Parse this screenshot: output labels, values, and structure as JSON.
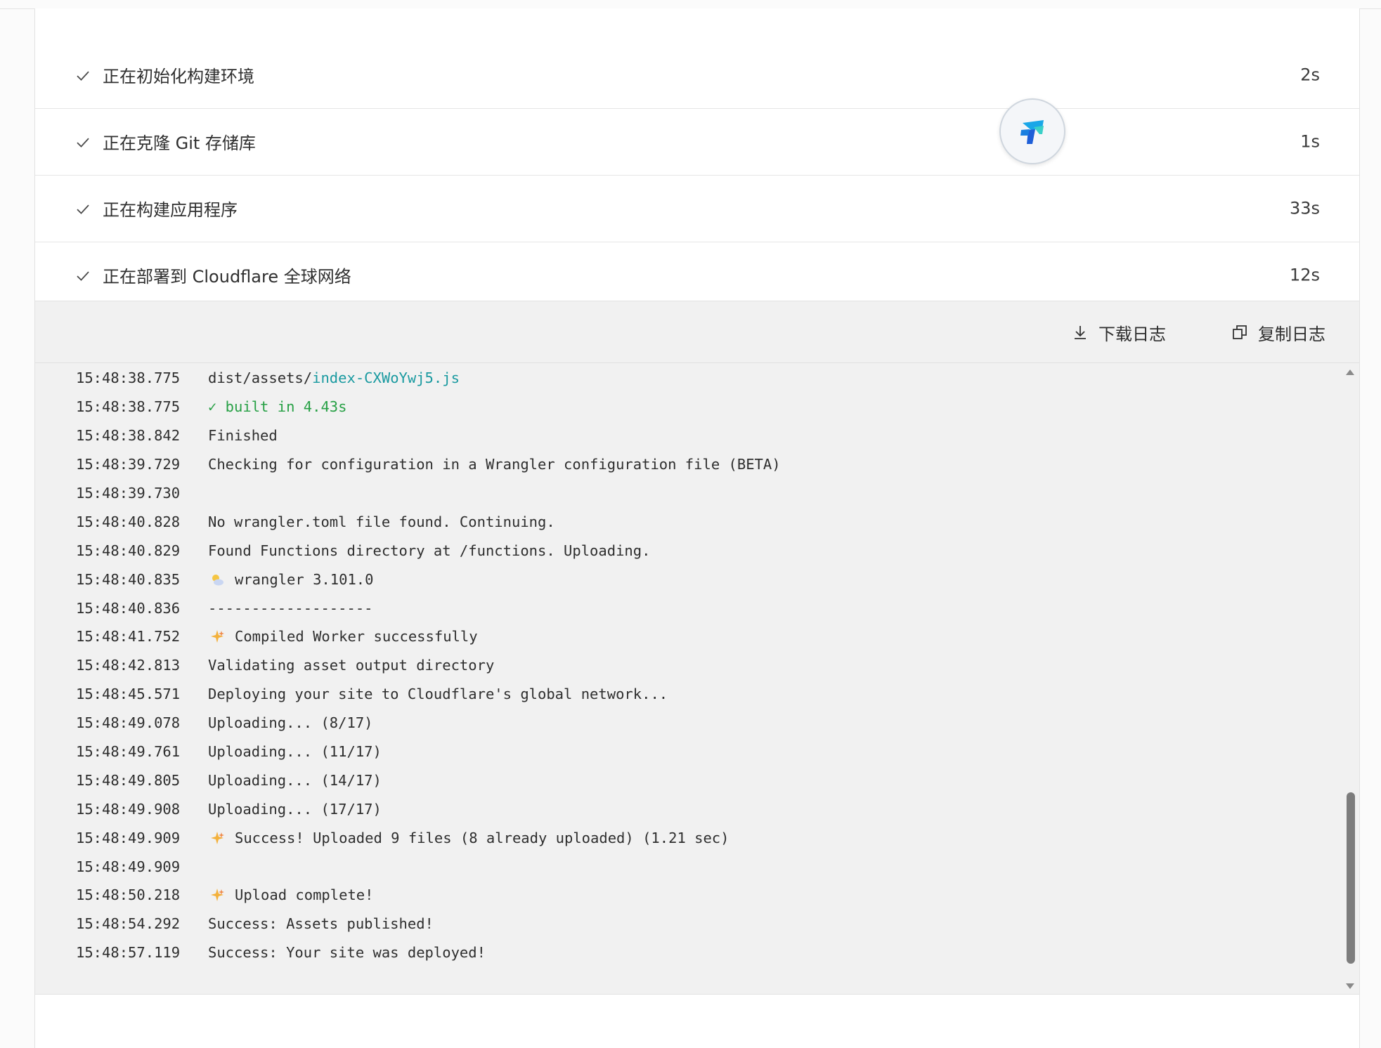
{
  "steps": [
    {
      "label": "正在初始化构建环境",
      "duration": "2s",
      "status_icon": "check-icon"
    },
    {
      "label": "正在克隆 Git 存储库",
      "duration": "1s",
      "status_icon": "check-icon"
    },
    {
      "label": "正在构建应用程序",
      "duration": "33s",
      "status_icon": "check-icon"
    },
    {
      "label": "正在部署到 Cloudflare 全球网络",
      "duration": "12s",
      "status_icon": "check-icon"
    }
  ],
  "toolbar": {
    "download_label": "下载日志",
    "download_icon": "download-icon",
    "copy_label": "复制日志",
    "copy_icon": "copy-icon"
  },
  "floating_badge": {
    "icon": "app-logo-icon",
    "colors": [
      "#1aa7e8",
      "#1e5fd8",
      "#3ad0c8"
    ]
  },
  "colors": {
    "success_green": "#27a045",
    "link_teal": "#1a9aa0",
    "log_background": "#f1f1f1",
    "check_color": "#4a4a4a"
  },
  "log": {
    "lines": [
      {
        "time": "15:48:38.775",
        "prefix": "dist/assets/",
        "text": "",
        "highlight": "index-CXWoYwj5.js",
        "highlight_color": "teal"
      },
      {
        "time": "15:48:38.775",
        "prefix": "",
        "text": "",
        "highlight": "✓ built in 4.43s",
        "highlight_color": "green"
      },
      {
        "time": "15:48:38.842",
        "prefix": "",
        "text": "Finished"
      },
      {
        "time": "15:48:39.729",
        "prefix": "",
        "text": "Checking for configuration in a Wrangler configuration file (BETA)"
      },
      {
        "time": "15:48:39.730",
        "prefix": "",
        "text": ""
      },
      {
        "time": "15:48:40.828",
        "prefix": "",
        "text": "No wrangler.toml file found. Continuing."
      },
      {
        "time": "15:48:40.829",
        "prefix": "",
        "text": "Found Functions directory at /functions. Uploading."
      },
      {
        "time": "15:48:40.835",
        "prefix": "",
        "text": "wrangler 3.101.0",
        "emoji": "weather-sun-cloud-icon"
      },
      {
        "time": "15:48:40.836",
        "prefix": "",
        "text": "-------------------"
      },
      {
        "time": "15:48:41.752",
        "prefix": "",
        "text": "Compiled Worker successfully",
        "emoji": "sparkles-icon"
      },
      {
        "time": "15:48:42.813",
        "prefix": "",
        "text": "Validating asset output directory"
      },
      {
        "time": "15:48:45.571",
        "prefix": "",
        "text": "Deploying your site to Cloudflare's global network..."
      },
      {
        "time": "15:48:49.078",
        "prefix": "",
        "text": "Uploading... (8/17)"
      },
      {
        "time": "15:48:49.761",
        "prefix": "",
        "text": "Uploading... (11/17)"
      },
      {
        "time": "15:48:49.805",
        "prefix": "",
        "text": "Uploading... (14/17)"
      },
      {
        "time": "15:48:49.908",
        "prefix": "",
        "text": "Uploading... (17/17)"
      },
      {
        "time": "15:48:49.909",
        "prefix": "",
        "text": "Success! Uploaded 9 files (8 already uploaded) (1.21 sec)",
        "emoji": "sparkles-icon"
      },
      {
        "time": "15:48:49.909",
        "prefix": "",
        "text": ""
      },
      {
        "time": "15:48:50.218",
        "prefix": "",
        "text": "Upload complete!",
        "emoji": "sparkles-icon"
      },
      {
        "time": "15:48:54.292",
        "prefix": "",
        "text": "Success: Assets published!"
      },
      {
        "time": "15:48:57.119",
        "prefix": "",
        "text": "Success: Your site was deployed!"
      }
    ]
  },
  "scrollbar": {
    "position_fraction": 0.76
  }
}
